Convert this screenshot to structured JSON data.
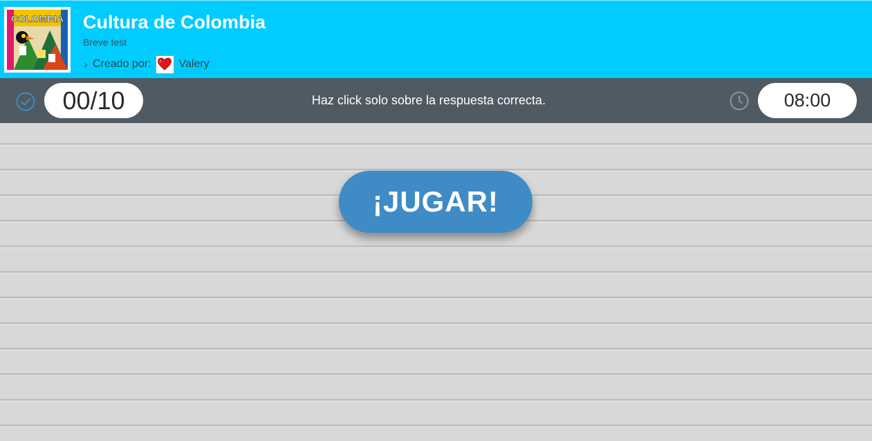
{
  "header": {
    "thumbnail_text": "COLOMBIA",
    "title": "Cultura de Colombia",
    "subtitle": "Breve test",
    "creator_label": "Creado por:",
    "creator_name": "Valery"
  },
  "toolbar": {
    "score": "00/10",
    "instructions": "Haz click solo sobre la respuesta correcta.",
    "timer": "08:00"
  },
  "main": {
    "play_label": "¡JUGAR!"
  },
  "icons": {
    "check": "check-circle-icon",
    "clock": "clock-icon",
    "chevron": "chevron-right-icon",
    "avatar": "heart-icon"
  },
  "colors": {
    "header_bg": "#00ccff",
    "toolbar_bg": "#4f5a63",
    "play_button": "#3f8bc6",
    "main_bg": "#d7d7d7"
  }
}
